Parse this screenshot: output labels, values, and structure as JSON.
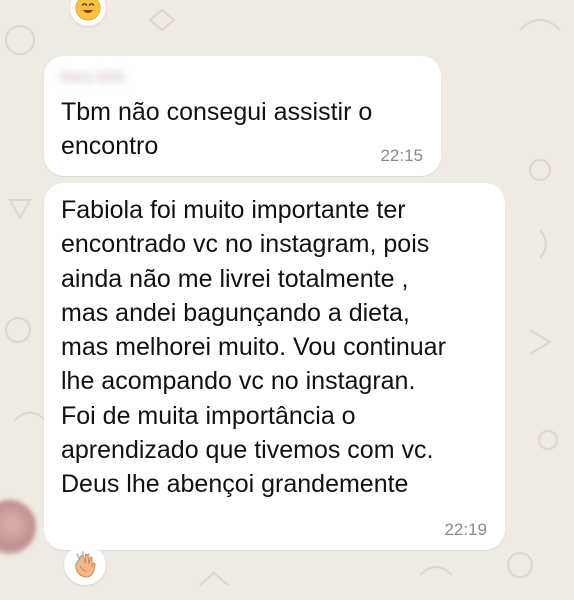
{
  "messages": [
    {
      "sender": "Maria NNN.",
      "text": "Tbm não consegui assistir o\nencontro",
      "time": "22:15"
    },
    {
      "text": "Fabiola foi muito importante ter\nencontrado vc no instagram, pois\nainda não me livrei totalmente ,\nmas andei bagunçando a dieta,\nmas melhorei muito. Vou continuar\nlhe acompando vc no instagran.\nFoi de muita importância o\naprendizado que tivemos com vc.\nDeus lhe abençoi grandemente",
      "time": "22:19"
    }
  ],
  "reactions": [
    {
      "icon": "smiling-face-emoji-icon"
    },
    {
      "icon": "clapping-hands-emoji-icon"
    }
  ],
  "colors": {
    "background": "#efeae2",
    "bubble": "#ffffff",
    "timestamp": "#8a8a8a"
  }
}
